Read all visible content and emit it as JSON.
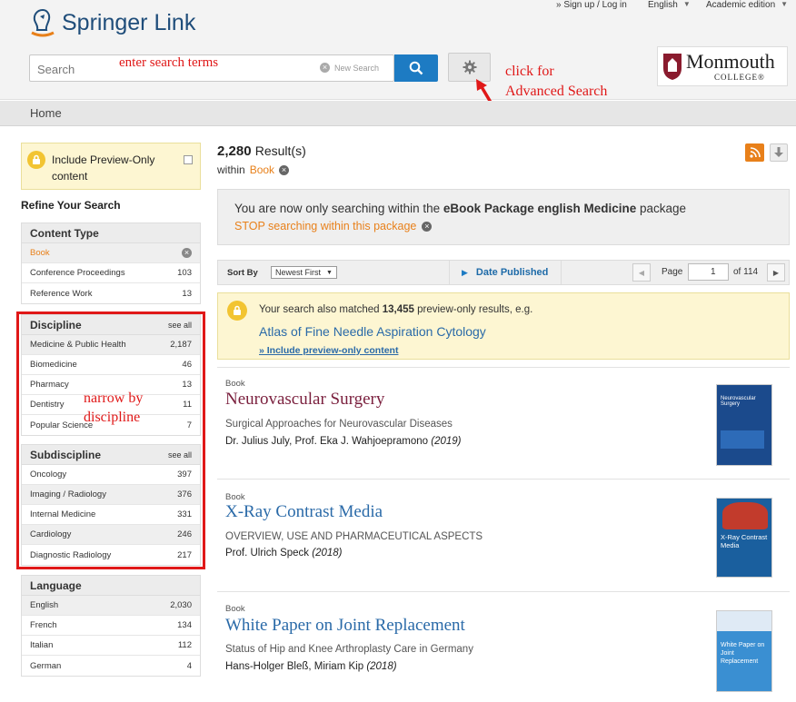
{
  "header": {
    "brand_main": "Springer",
    "brand_sub": "Link",
    "signup": "» Sign up / Log in",
    "language": "English",
    "edition": "Academic edition",
    "search_placeholder": "Search",
    "new_search": "New Search",
    "institution_name": "Monmouth",
    "institution_sub": "COLLEGE®"
  },
  "annotations": {
    "search_hint": "enter search terms",
    "advanced_line1": "click for",
    "advanced_line2": "Advanced Search",
    "discipline_line1": "narrow by",
    "discipline_line2": "discipline"
  },
  "nav": {
    "home": "Home"
  },
  "sidebar": {
    "preview_line1": "Include Preview-Only",
    "preview_line2": "content",
    "refine": "Refine Your Search",
    "content_type": {
      "title": "Content Type",
      "items": [
        {
          "label": "Book",
          "count": ""
        },
        {
          "label": "Conference Proceedings",
          "count": "103"
        },
        {
          "label": "Reference Work",
          "count": "13"
        }
      ]
    },
    "discipline": {
      "title": "Discipline",
      "see_all": "see all",
      "items": [
        {
          "label": "Medicine & Public Health",
          "count": "2,187"
        },
        {
          "label": "Biomedicine",
          "count": "46"
        },
        {
          "label": "Pharmacy",
          "count": "13"
        },
        {
          "label": "Dentistry",
          "count": "11"
        },
        {
          "label": "Popular Science",
          "count": "7"
        }
      ]
    },
    "subdiscipline": {
      "title": "Subdiscipline",
      "see_all": "see all",
      "items": [
        {
          "label": "Oncology",
          "count": "397"
        },
        {
          "label": "Imaging / Radiology",
          "count": "376"
        },
        {
          "label": "Internal Medicine",
          "count": "331"
        },
        {
          "label": "Cardiology",
          "count": "246"
        },
        {
          "label": "Diagnostic Radiology",
          "count": "217"
        }
      ]
    },
    "language": {
      "title": "Language",
      "items": [
        {
          "label": "English",
          "count": "2,030"
        },
        {
          "label": "French",
          "count": "134"
        },
        {
          "label": "Italian",
          "count": "112"
        },
        {
          "label": "German",
          "count": "4"
        }
      ]
    }
  },
  "main": {
    "count": "2,280",
    "count_label": "Result(s)",
    "within_label": "within",
    "within_value": "Book",
    "pkg_pre": "You are now only searching within the ",
    "pkg_name": "eBook Package english Medicine",
    "pkg_post": " package",
    "pkg_stop": "STOP searching within this package",
    "sort_label": "Sort By",
    "sort_value": "Newest First",
    "date_published": "Date Published",
    "page_label": "Page",
    "page_value": "1",
    "page_of": "of 114",
    "matched_pre": "Your search also matched ",
    "matched_num": "13,455",
    "matched_post": " preview-only results, e.g.",
    "matched_title": "Atlas of Fine Needle Aspiration Cytology",
    "matched_link": "» Include preview-only content",
    "results": [
      {
        "type": "Book",
        "title": "Neurovascular Surgery",
        "subtitle": "Surgical Approaches for Neurovascular Diseases",
        "authors": "Dr. Julius July, Prof. Eka J. Wahjoepramono",
        "year": "(2019)",
        "cover_title": "Neurovascular Surgery"
      },
      {
        "type": "Book",
        "title": "X-Ray Contrast Media",
        "subtitle": "OVERVIEW, USE AND PHARMACEUTICAL ASPECTS",
        "authors": "Prof. Ulrich Speck",
        "year": "(2018)",
        "cover_title": "X-Ray Contrast Media"
      },
      {
        "type": "Book",
        "title": "White Paper on Joint Replacement",
        "subtitle": "Status of Hip and Knee Arthroplasty Care in Germany",
        "authors": "Hans-Holger Bleß, Miriam Kip",
        "year": "(2018)",
        "cover_title": "White Paper on Joint Replacement"
      }
    ]
  },
  "colors": {
    "accent_blue": "#1d7bc3",
    "link_blue": "#2a6aa8",
    "title_maroon": "#7a1f3d",
    "orange": "#e8801a",
    "annotation_red": "#e01818"
  }
}
